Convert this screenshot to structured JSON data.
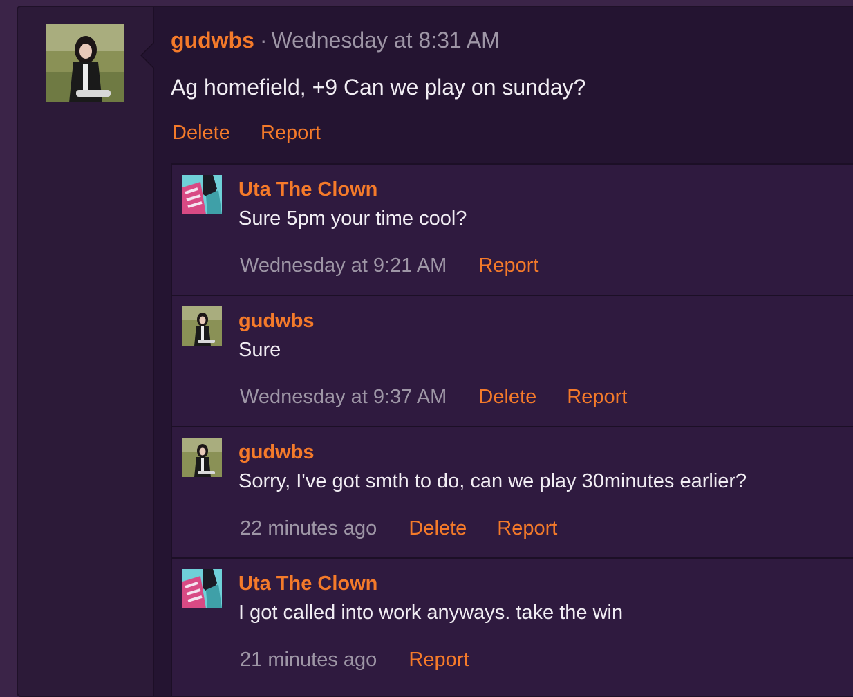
{
  "post": {
    "author": "gudwbs",
    "separator": "·",
    "time": "Wednesday at 8:31 AM",
    "body": "Ag homefield, +9 Can we play on sunday?",
    "actions": {
      "delete": "Delete",
      "report": "Report"
    }
  },
  "replies": [
    {
      "author": "Uta The Clown",
      "text": "Sure 5pm your time cool?",
      "time": "Wednesday at 9:21 AM",
      "report": "Report"
    },
    {
      "author": "gudwbs",
      "text": "Sure",
      "time": "Wednesday at 9:37 AM",
      "delete": "Delete",
      "report": "Report"
    },
    {
      "author": "gudwbs",
      "text": "Sorry, I've got smth to do, can we play 30minutes earlier?",
      "time": "22 minutes ago",
      "delete": "Delete",
      "report": "Report"
    },
    {
      "author": "Uta The Clown",
      "text": "I got called into work anyways. take the win",
      "time": "21 minutes ago",
      "report": "Report"
    }
  ],
  "colors": {
    "accent": "#f47a2a",
    "background": "#2a1836",
    "text": "#f1edf3",
    "muted": "#9e96a6"
  }
}
